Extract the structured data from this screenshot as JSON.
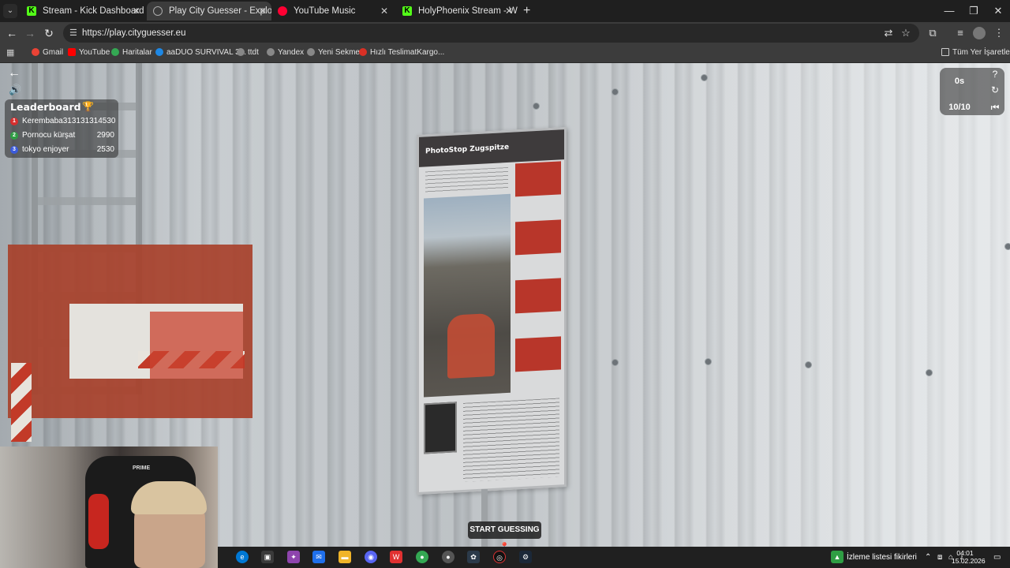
{
  "browser": {
    "tabs": [
      {
        "title": "Stream - Kick Dashboard",
        "active": false
      },
      {
        "title": "Play City Guesser - Explore the",
        "active": true
      },
      {
        "title": "YouTube Music",
        "active": false
      },
      {
        "title": "HolyPhoenix Stream - Watch Li",
        "active": false
      }
    ],
    "new_tab": "+",
    "url": "https://play.cityguesser.eu",
    "bookmarks": [
      "Gmail",
      "YouTube",
      "Haritalar",
      "aaDUO SURVIVAL 3...",
      "ttdt",
      "Yandex",
      "Yeni Sekme",
      "Hızlı TeslimatKargo..."
    ],
    "all_bookmarks": "Tüm Yer İşaretleri"
  },
  "game": {
    "leaderboard": {
      "title": "Leaderboard",
      "entries": [
        {
          "rank": "1",
          "name": "Kerembaba",
          "score": "313131314530"
        },
        {
          "rank": "2",
          "name": "Pornocu kürşat",
          "score": "2990"
        },
        {
          "rank": "3",
          "name": "tokyo enjoyer",
          "score": "2530"
        }
      ]
    },
    "timer": "0s",
    "round": "10/10",
    "start_button": "START GUESSING",
    "sign_title": "PhotoStop Zugspitze",
    "sign_brand": "Zugspitze",
    "webcam_brand": "PRIME"
  },
  "taskbar": {
    "news": "İzleme listesi fikirleri",
    "time": "04:01",
    "date": "15.02.2026"
  }
}
